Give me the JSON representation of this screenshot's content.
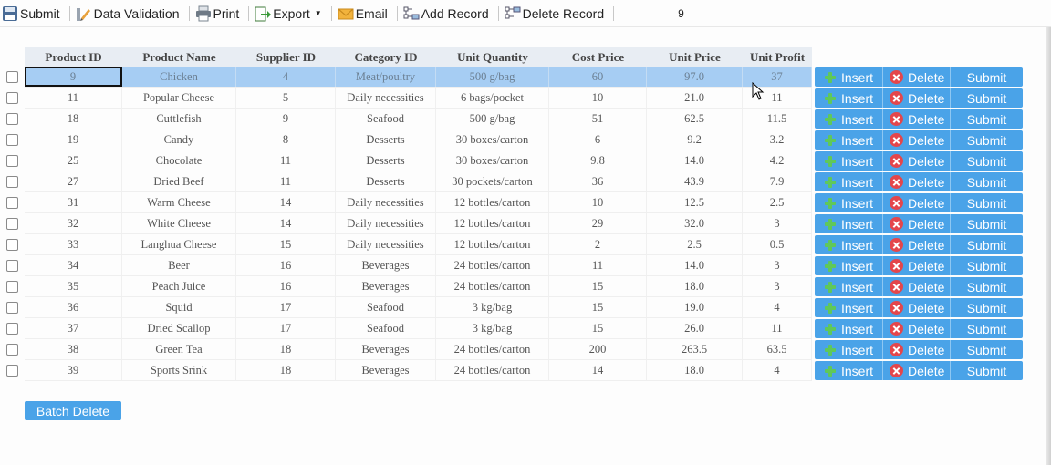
{
  "toolbar": {
    "submit": "Submit",
    "data_validation": "Data Validation",
    "print": "Print",
    "export": "Export",
    "email": "Email",
    "add_record": "Add Record",
    "delete_record": "Delete Record",
    "value": "9"
  },
  "columns": [
    "Product ID",
    "Product Name",
    "Supplier ID",
    "Category ID",
    "Unit Quantity",
    "Cost Price",
    "Unit Price",
    "Unit Profit"
  ],
  "rows": [
    [
      "9",
      "Chicken",
      "4",
      "Meat/poultry",
      "500 g/bag",
      "60",
      "97.0",
      "37"
    ],
    [
      "11",
      "Popular Cheese",
      "5",
      "Daily necessities",
      "6 bags/pocket",
      "10",
      "21.0",
      "11"
    ],
    [
      "18",
      "Cuttlefish",
      "9",
      "Seafood",
      "500 g/bag",
      "51",
      "62.5",
      "11.5"
    ],
    [
      "19",
      "Candy",
      "8",
      "Desserts",
      "30 boxes/carton",
      "6",
      "9.2",
      "3.2"
    ],
    [
      "25",
      "Chocolate",
      "11",
      "Desserts",
      "30 boxes/carton",
      "9.8",
      "14.0",
      "4.2"
    ],
    [
      "27",
      "Dried Beef",
      "11",
      "Desserts",
      "30 pockets/carton",
      "36",
      "43.9",
      "7.9"
    ],
    [
      "31",
      "Warm Cheese",
      "14",
      "Daily necessities",
      "12 bottles/carton",
      "10",
      "12.5",
      "2.5"
    ],
    [
      "32",
      "White Cheese",
      "14",
      "Daily necessities",
      "12 bottles/carton",
      "29",
      "32.0",
      "3"
    ],
    [
      "33",
      "Langhua Cheese",
      "15",
      "Daily necessities",
      "12 bottles/carton",
      "2",
      "2.5",
      "0.5"
    ],
    [
      "34",
      "Beer",
      "16",
      "Beverages",
      "24 bottles/carton",
      "11",
      "14.0",
      "3"
    ],
    [
      "35",
      "Peach Juice",
      "16",
      "Beverages",
      "24 bottles/carton",
      "15",
      "18.0",
      "3"
    ],
    [
      "36",
      "Squid",
      "17",
      "Seafood",
      "3 kg/bag",
      "15",
      "19.0",
      "4"
    ],
    [
      "37",
      "Dried Scallop",
      "17",
      "Seafood",
      "3 kg/bag",
      "15",
      "26.0",
      "11"
    ],
    [
      "38",
      "Green Tea",
      "18",
      "Beverages",
      "24 bottles/carton",
      "200",
      "263.5",
      "63.5"
    ],
    [
      "39",
      "Sports Srink",
      "18",
      "Beverages",
      "24 bottles/carton",
      "14",
      "18.0",
      "4"
    ]
  ],
  "actions": {
    "insert": "Insert",
    "delete": "Delete",
    "submit": "Submit"
  },
  "batch_delete": "Batch Delete",
  "selected_row_index": 0,
  "colors": {
    "button": "#4aa3e8",
    "selected_row": "#a6cdf3",
    "header_bg": "#e8edf3",
    "insert_icon": "#5fc85a",
    "delete_icon": "#e4464b"
  }
}
